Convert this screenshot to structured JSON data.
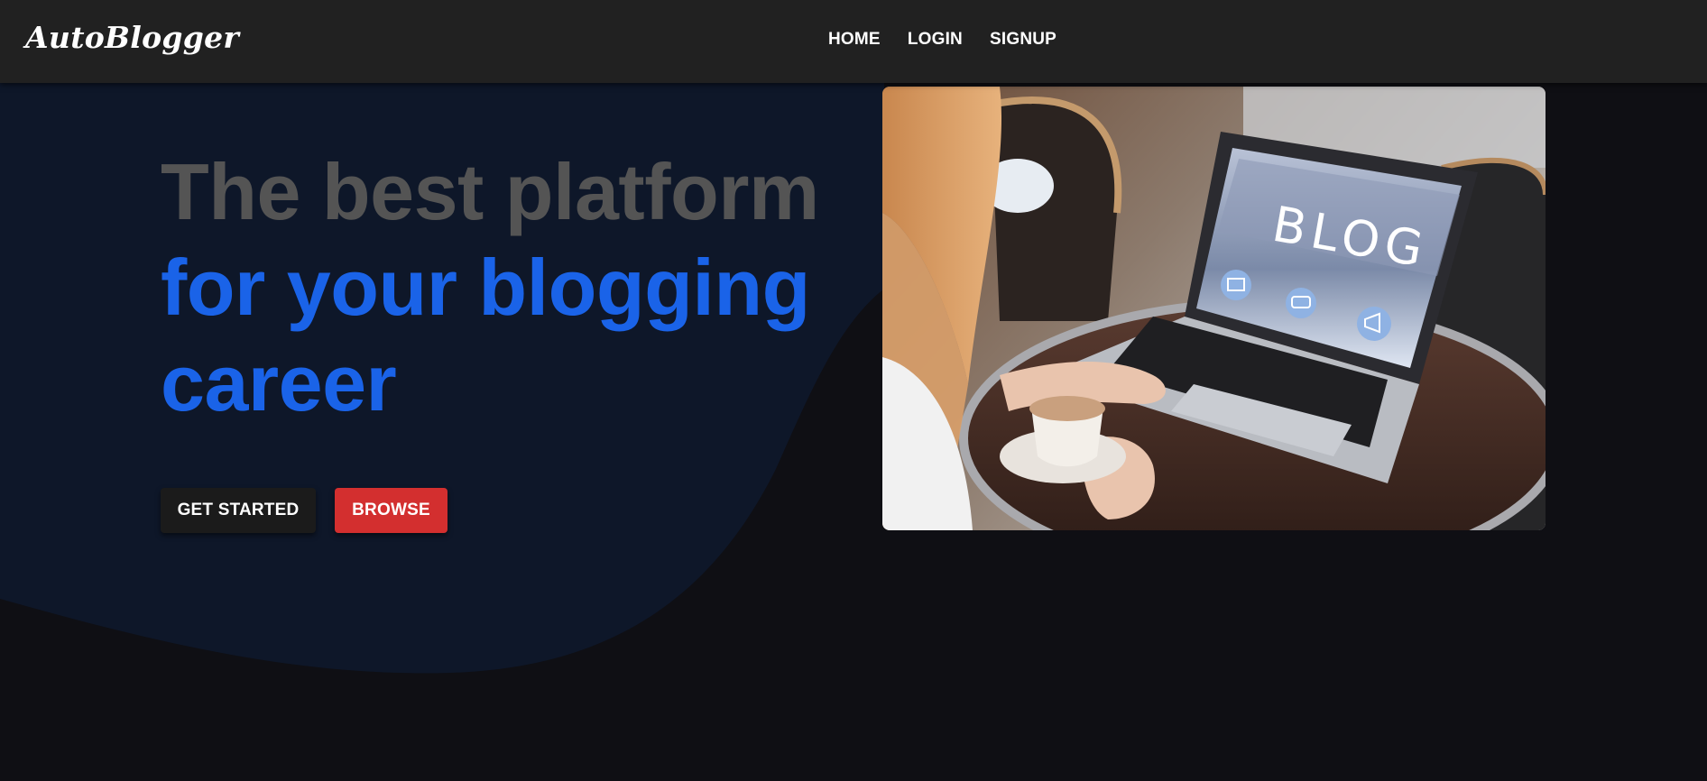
{
  "navbar": {
    "brand": "AutoBlogger",
    "links": [
      "HOME",
      "LOGIN",
      "SIGNUP"
    ]
  },
  "hero": {
    "title_line_1": "The best platform",
    "title_line_2": "for your blogging",
    "title_line_3": "career",
    "get_started_label": "GET STARTED",
    "browse_label": "BROWSE"
  },
  "image": {
    "screen_text": "BLOG",
    "screen_icons": [
      "mail-icon",
      "chat-icon",
      "megaphone-icon"
    ]
  },
  "colors": {
    "page_background": "#0f0f14",
    "wave_navy": "#0e1729",
    "navbar": "#212121",
    "title_grey": "#545454",
    "title_blue": "#1a63e8",
    "browse_red": "#d32f2f",
    "get_started_dark": "#1b1b1b"
  }
}
